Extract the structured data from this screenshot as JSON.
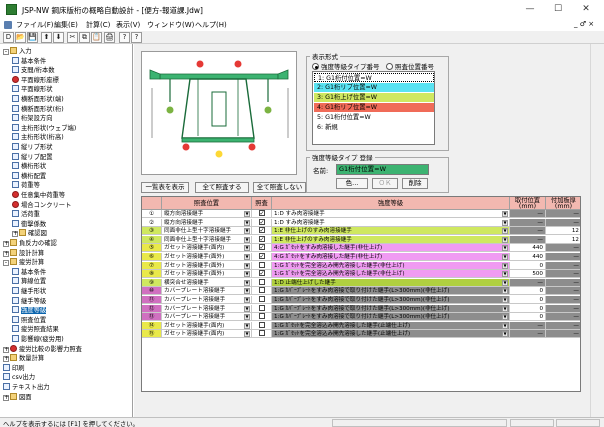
{
  "titlebar": {
    "title": "JSP-NW 鋼床版桁の概略自動設計 - [便方-報道課.Jdw]",
    "min": "—",
    "max": "☐",
    "close": "✕"
  },
  "menubar": {
    "items": [
      "ファイル(F)",
      "編集(E)",
      "計算(C)",
      "表示(V)",
      "ウィンドウ(W)",
      "ヘルプ(H)"
    ],
    "right": "_ ♂ ×"
  },
  "toolbar": {
    "buttons": [
      "D",
      "📂",
      "💾",
      "⬆",
      "⬇",
      "✂",
      "⧉",
      "📋",
      "🖨",
      "?",
      "?"
    ]
  },
  "tree": {
    "items": [
      {
        "label": "入力",
        "level": 0,
        "kind": "fold",
        "exp": "-"
      },
      {
        "label": "基本条件",
        "level": 1,
        "kind": "doc"
      },
      {
        "label": "支間/桁本数",
        "level": 1,
        "kind": "doc"
      },
      {
        "label": "平面線形座標",
        "level": 1,
        "kind": "red"
      },
      {
        "label": "平面線形状",
        "level": 1,
        "kind": "doc"
      },
      {
        "label": "横断面形状(端)",
        "level": 1,
        "kind": "doc"
      },
      {
        "label": "横断面形状(桁)",
        "level": 1,
        "kind": "doc"
      },
      {
        "label": "桁架設方向",
        "level": 1,
        "kind": "doc"
      },
      {
        "label": "主桁形状(ウェブ端)",
        "level": 1,
        "kind": "doc"
      },
      {
        "label": "主桁形状(桁高)",
        "level": 1,
        "kind": "doc"
      },
      {
        "label": "縦リブ形状",
        "level": 1,
        "kind": "doc"
      },
      {
        "label": "縦リブ配置",
        "level": 1,
        "kind": "doc"
      },
      {
        "label": "横桁形状",
        "level": 1,
        "kind": "doc"
      },
      {
        "label": "横桁配置",
        "level": 1,
        "kind": "doc"
      },
      {
        "label": "荷重等",
        "level": 1,
        "kind": "doc"
      },
      {
        "label": "任意集中荷重等",
        "level": 1,
        "kind": "red"
      },
      {
        "label": "場合コンクリート",
        "level": 1,
        "kind": "red"
      },
      {
        "label": "活荷重",
        "level": 1,
        "kind": "doc"
      },
      {
        "label": "衝撃係数",
        "level": 1,
        "kind": "doc"
      },
      {
        "label": "確認図",
        "level": 1,
        "kind": "fold",
        "exp": "+"
      },
      {
        "label": "負反力の確認",
        "level": 0,
        "kind": "fold",
        "exp": "+"
      },
      {
        "label": "設計計算",
        "level": 0,
        "kind": "fold",
        "exp": "+"
      },
      {
        "label": "疲労計算",
        "level": 0,
        "kind": "fold",
        "exp": "-"
      },
      {
        "label": "基本条件",
        "level": 1,
        "kind": "doc"
      },
      {
        "label": "算線位置",
        "level": 1,
        "kind": "doc"
      },
      {
        "label": "継手形状",
        "level": 1,
        "kind": "doc"
      },
      {
        "label": "継手等級",
        "level": 1,
        "kind": "doc"
      },
      {
        "label": "強度等級",
        "level": 1,
        "kind": "doc",
        "selected": true
      },
      {
        "label": "照査位置",
        "level": 1,
        "kind": "doc"
      },
      {
        "label": "疲労照査結果",
        "level": 1,
        "kind": "doc"
      },
      {
        "label": "影響線(疲労用)",
        "level": 1,
        "kind": "doc"
      },
      {
        "label": "疲労比較の影響力照査",
        "level": 0,
        "kind": "red",
        "exp": "+"
      },
      {
        "label": "数量計算",
        "level": 0,
        "kind": "fold",
        "exp": "+"
      },
      {
        "label": "印刷",
        "level": 0,
        "kind": "doc"
      },
      {
        "label": "csv出力",
        "level": 0,
        "kind": "doc"
      },
      {
        "label": "テキスト出力",
        "level": 0,
        "kind": "doc"
      },
      {
        "label": "図面",
        "level": 0,
        "kind": "fold",
        "exp": "+"
      }
    ]
  },
  "display": {
    "group_title": "表示形式",
    "radio1": "強度等級タイプ番号",
    "radio2": "照査位置番号",
    "list": [
      {
        "label": "1: G1桁付位置=W",
        "color": "#ffffff"
      },
      {
        "label": "2: G1桁リブ位置=W",
        "color": "#59e3f2"
      },
      {
        "label": "3: G1桁上げ位置=W",
        "color": "#cfe860"
      },
      {
        "label": "4: G1桁リブ位置=W",
        "color": "#f06b58"
      },
      {
        "label": "5: G1桁付位置=W",
        "color": "#ffffff"
      },
      {
        "label": "6: 新規",
        "color": "#ffffff"
      }
    ]
  },
  "type_reg": {
    "group_title": "強度等級タイプ 登録",
    "name_label": "名前:",
    "name_value": "G1桁付位置=W",
    "color_btn": "色...",
    "ok_btn": "ＯＫ",
    "delete_btn": "削除"
  },
  "grid_buttons": {
    "show_all": "一覧表を表示",
    "check_all": "全て照査する",
    "check_none": "全て照査しない"
  },
  "grid": {
    "headers": [
      "照査位置",
      "照査",
      "強度等級",
      "取付位置\n(mm)",
      "付加板厚\n(mm)"
    ],
    "rows": [
      {
        "no": "①",
        "color": "#ffffff",
        "pos": "縦方向溶接継手",
        "chk": true,
        "grade": "1:D すみ肉溶接継手",
        "gcolor": "#ffffff",
        "v1": "—",
        "v2": "—"
      },
      {
        "no": "②",
        "color": "#ffffff",
        "pos": "縦方向溶接継手",
        "chk": true,
        "grade": "1:D すみ肉溶接継手",
        "gcolor": "#ffffff",
        "v1": "—",
        "v2": "—"
      },
      {
        "no": "③",
        "color": "#cfe860",
        "pos": "同面非仕上型十字溶接継手",
        "chk": true,
        "grade": "1:E 非仕上げのすみ肉溶接継手",
        "gcolor": "#cfe860",
        "v1": "—",
        "v2": "12"
      },
      {
        "no": "④",
        "color": "#cfe860",
        "pos": "同面非仕上型十字溶接継手",
        "chk": true,
        "grade": "1:E 非仕上げのすみ肉溶接継手",
        "gcolor": "#cfe860",
        "v1": "—",
        "v2": "12"
      },
      {
        "no": "⑤",
        "color": "#e9e94a",
        "pos": "ガセット溶接継手(面内)",
        "chk": true,
        "grade": "4:G ｶﾞｾｯﾄをすみ肉溶接した継手(非仕上げ)",
        "gcolor": "#f09bf2",
        "v1": "440",
        "v2": "—"
      },
      {
        "no": "⑥",
        "color": "#e9e94a",
        "pos": "ガセット溶接継手(面外)",
        "chk": true,
        "grade": "4:G ｶﾞｾｯﾄをすみ肉溶接した継手(非仕上げ)",
        "gcolor": "#f09bf2",
        "v1": "440",
        "v2": "—"
      },
      {
        "no": "⑦",
        "color": "#e9e94a",
        "pos": "ガセット溶接継手(面外)",
        "chk": false,
        "grade": "1:G ｶﾞｾｯﾄを完全溶込み開先溶接した継手(非仕上げ)",
        "gcolor": "#f09bf2",
        "v1": "0",
        "v2": "—"
      },
      {
        "no": "⑧",
        "color": "#e9e94a",
        "pos": "ガセット溶接継手(面外)",
        "chk": true,
        "grade": "1:G ｶﾞｾｯﾄを完全溶込み開先溶接した継手(非仕上げ)",
        "gcolor": "#f09bf2",
        "v1": "500",
        "v2": "—"
      },
      {
        "no": "⑨",
        "color": "#cfe860",
        "pos": "横突合せ溶接継手",
        "chk": false,
        "grade": "1:D 止端仕上げした継手",
        "gcolor": "#b0d040",
        "v1": "—",
        "v2": "—"
      },
      {
        "no": "⑩",
        "color": "#d070c0",
        "pos": "カバープレート溶接継手",
        "chk": false,
        "grade": "1:G ｶﾊﾞｰﾌﾟﾚｰﾄをすみ肉溶接で取り付けた継手(L>300mm)(非仕上げ)",
        "gcolor": "#8d8d8d",
        "v1": "0",
        "v2": "—"
      },
      {
        "no": "⑪",
        "color": "#d070c0",
        "pos": "カバープレート溶接継手",
        "chk": false,
        "grade": "1:G ｶﾊﾞｰﾌﾟﾚｰﾄをすみ肉溶接で取り付けた継手(L>300mm)(非仕上げ)",
        "gcolor": "#8d8d8d",
        "v1": "0",
        "v2": "—"
      },
      {
        "no": "⑫",
        "color": "#d070c0",
        "pos": "カバープレート溶接継手",
        "chk": false,
        "grade": "1:G ｶﾊﾞｰﾌﾟﾚｰﾄをすみ肉溶接で取り付けた継手(L>300mm)(非仕上げ)",
        "gcolor": "#8d8d8d",
        "v1": "0",
        "v2": "—"
      },
      {
        "no": "⑬",
        "color": "#d070c0",
        "pos": "カバープレート溶接継手",
        "chk": false,
        "grade": "1:G ｶﾊﾞｰﾌﾟﾚｰﾄをすみ肉溶接で取り付けた継手(L>300mm)(非仕上げ)",
        "gcolor": "#8d8d8d",
        "v1": "0",
        "v2": "—"
      },
      {
        "no": "⑭",
        "color": "#e9e94a",
        "pos": "ガセット溶接継手(面内)",
        "chk": false,
        "grade": "1:G ｶﾞｾｯﾄを完全溶込み開先溶接した継手(止端仕上げ)",
        "gcolor": "#8d8d8d",
        "v1": "—",
        "v2": "—"
      },
      {
        "no": "⑮",
        "color": "#e9e94a",
        "pos": "ガセット溶接継手(面内)",
        "chk": false,
        "grade": "1:G ｶﾞｾｯﾄを完全溶込み開先溶接した継手(止端仕上げ)",
        "gcolor": "#8d8d8d",
        "v1": "—",
        "v2": "—"
      }
    ]
  },
  "status": {
    "text": "ヘルプを表示するには [F1] を押してください。"
  }
}
